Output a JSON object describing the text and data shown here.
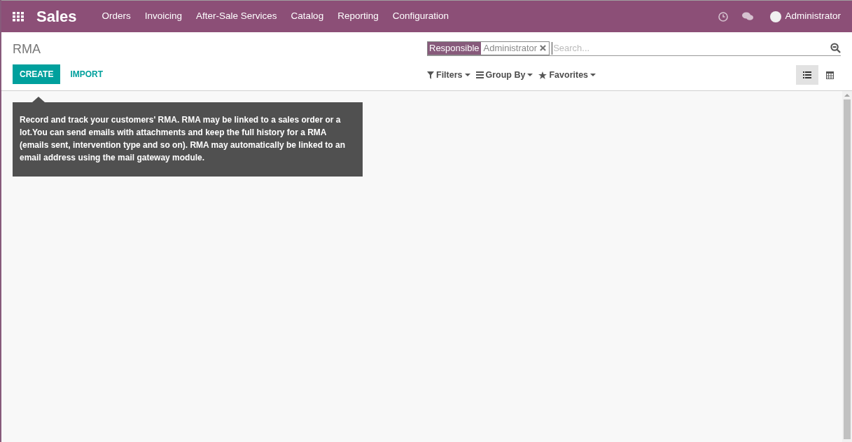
{
  "app": {
    "title": "Sales"
  },
  "menu": [
    "Orders",
    "Invoicing",
    "After-Sale Services",
    "Catalog",
    "Reporting",
    "Configuration"
  ],
  "user": {
    "name": "Administrator"
  },
  "breadcrumb": "RMA",
  "buttons": {
    "create": "CREATE",
    "import": "IMPORT"
  },
  "search": {
    "facet_label": "Responsible",
    "facet_value": "Administrator",
    "placeholder": "Search..."
  },
  "search_options": [
    "Filters",
    "Group By",
    "Favorites"
  ],
  "views": [
    {
      "kind": "list",
      "selected": true
    },
    {
      "kind": "calendar",
      "selected": false
    }
  ],
  "help_tip": "Record and track your customers' RMA. RMA may be linked to a sales order or a lot.You can send emails with attachments and keep the full history for a RMA (emails sent, intervention type and so on). RMA may automatically be linked to an email address using the mail gateway module."
}
